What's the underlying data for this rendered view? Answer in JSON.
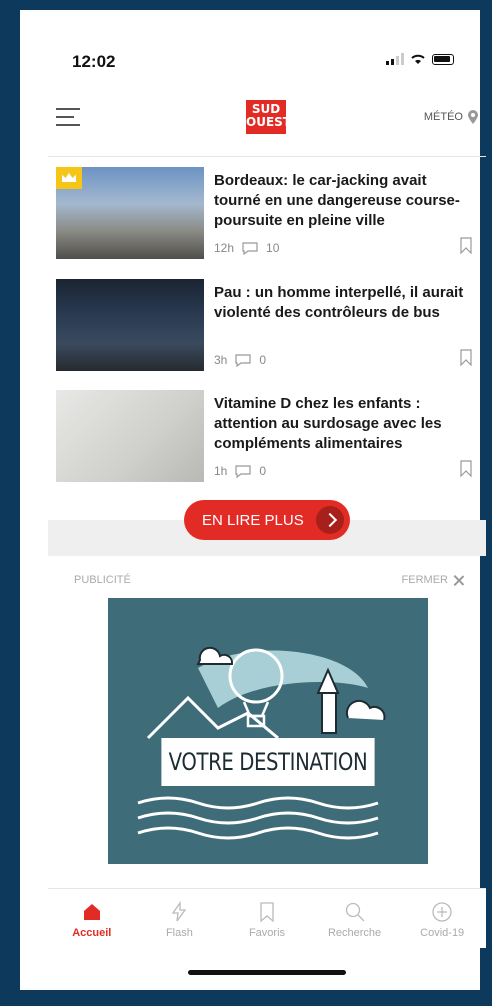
{
  "status": {
    "time": "12:02"
  },
  "header": {
    "logo_line1": "SUD",
    "logo_line2": "OUEST",
    "meteo_label": "MÉTÉO"
  },
  "articles": [
    {
      "title": "Bordeaux: le car-jacking avait tourné en une dangereuse course-poursuite en pleine ville",
      "age": "12h",
      "comments": "10",
      "premium": true
    },
    {
      "title": "Pau : un homme interpellé, il aurait violenté des contrôleurs de bus",
      "age": "3h",
      "comments": "0",
      "premium": false
    },
    {
      "title": "Vitamine D chez les enfants : attention au surdosage avec les compléments alimentaires",
      "age": "1h",
      "comments": "0",
      "premium": false
    }
  ],
  "more_button": {
    "label": "EN LIRE PLUS"
  },
  "ad": {
    "label": "PUBLICITÉ",
    "close_label": "FERMER",
    "banner_text": "VOTRE DESTINATION"
  },
  "tabs": [
    {
      "label": "Accueil",
      "icon": "home-icon",
      "active": true
    },
    {
      "label": "Flash",
      "icon": "lightning-icon",
      "active": false
    },
    {
      "label": "Favoris",
      "icon": "bookmark-icon",
      "active": false
    },
    {
      "label": "Recherche",
      "icon": "search-icon",
      "active": false
    },
    {
      "label": "Covid-19",
      "icon": "plus-circle-icon",
      "active": false
    }
  ],
  "colors": {
    "accent": "#e32b25",
    "frame": "#0d3a5c",
    "ad_bg": "#3e6c78"
  }
}
